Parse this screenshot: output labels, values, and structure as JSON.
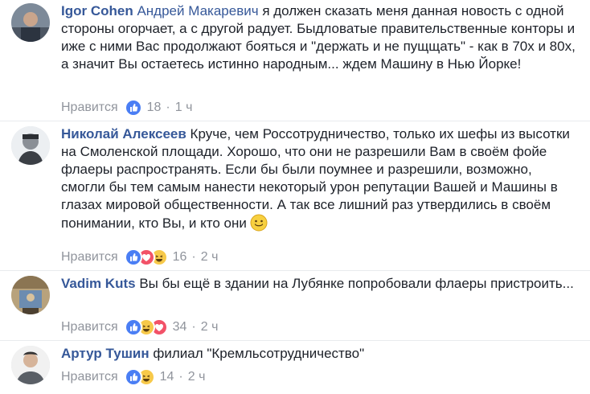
{
  "comments": [
    {
      "author": "Igor Cohen",
      "mention": "Андрей Макаревич",
      "text": "я должен сказать меня данная новость с одной стороны огорчает, а с другой радует. Быдловатые правительственные конторы и иже с ними Вас продолжают бояться и \"держать и не пущщать\" - как в 70х и 80х, а значит Вы остаетесь истинно народным... ждем Машину в Нью Йорке!",
      "like_label": "Нравится",
      "reaction_count": "18",
      "time": "1 ч",
      "reactions": [
        "like-icon"
      ]
    },
    {
      "author": "Николай Алексеев",
      "mention": "",
      "text": "Круче, чем Россотрудничество, только их шефы из высотки на Смоленской площади. Хорошо, что они не разрешили Вам в своём фойе флаеры распространять. Если бы были поумнее и разрешили, возможно, смогли бы тем самым нанести некоторый урон репутации Вашей и Машины в глазах мировой общественности. А так все лишний раз утвердились в своём понимании, кто Вы, и кто они",
      "emoji": "smile-emoji",
      "like_label": "Нравится",
      "reaction_count": "16",
      "time": "2 ч",
      "reactions": [
        "like-icon",
        "love-icon",
        "haha-icon"
      ]
    },
    {
      "author": "Vadim Kuts",
      "mention": "",
      "text": "Вы бы ещё в здании на Лубянке попробовали флаеры пристроить...",
      "like_label": "Нравится",
      "reaction_count": "34",
      "time": "2 ч",
      "reactions": [
        "like-icon",
        "haha-icon",
        "love-icon"
      ]
    },
    {
      "author": "Артур Тушин",
      "mention": "",
      "text": "филиал \"Кремльсотрудничество\"",
      "like_label": "Нравится",
      "reaction_count": "14",
      "time": "2 ч",
      "reactions": [
        "like-icon",
        "haha-icon"
      ]
    }
  ],
  "colors": {
    "author": "#365899",
    "meta": "#90949c",
    "like": "#4a7ef4",
    "love": "#f25268",
    "haha": "#f7c94a"
  }
}
